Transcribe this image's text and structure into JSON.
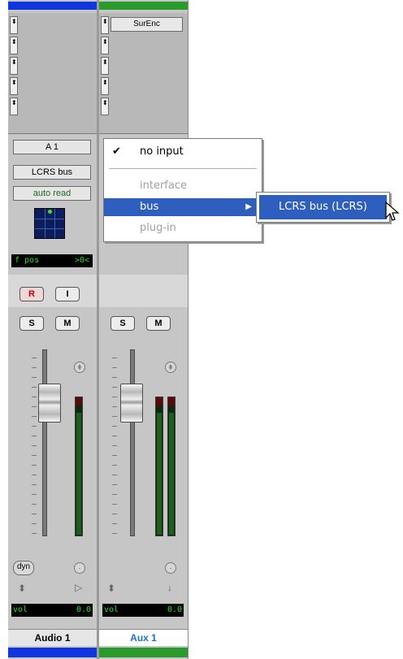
{
  "colors": {
    "audio1_track": "#1036e0",
    "aux1_track": "#2a9a2a",
    "lcd_text": "#22e322",
    "menu_highlight": "#2e5fbf",
    "record_red": "#cc0000",
    "selected_name": "#1a6fd6"
  },
  "strips": [
    {
      "name": "Audio 1",
      "insert_labels": [
        "",
        "",
        "",
        "",
        ""
      ],
      "input": "A 1",
      "output": "LCRS bus",
      "automation": "auto read",
      "pan_lcd": {
        "left": "f pos",
        "right": ">0<"
      },
      "buttons": {
        "rec": "R",
        "input": "I",
        "solo": "S",
        "mute": "M"
      },
      "dyn_label": "dyn",
      "vol_lcd": {
        "left": "vol",
        "right": "0.0"
      }
    },
    {
      "name": "Aux 1",
      "insert_labels": [
        "SurEnc",
        "",
        "",
        "",
        ""
      ],
      "buttons": {
        "solo": "S",
        "mute": "M"
      },
      "vol_lcd": {
        "left": "vol",
        "right": "0.0"
      }
    }
  ],
  "input_menu": {
    "items": [
      {
        "label": "no input",
        "checked": true,
        "enabled": true
      },
      {
        "label": "interface",
        "enabled": false
      },
      {
        "label": "bus",
        "enabled": true,
        "highlighted": true,
        "has_submenu": true
      },
      {
        "label": "plug-in",
        "enabled": false
      }
    ],
    "submenu": {
      "items": [
        {
          "label": "LCRS bus (LCRS)",
          "highlighted": true
        }
      ]
    }
  },
  "icons": {
    "check": "check-icon",
    "submenu_arrow": "chevron-right-icon",
    "cursor": "mouse-pointer-icon",
    "insert_selector": "up-down-arrow-icon",
    "output_pan": "output-arrow-icon",
    "aux_output": "down-arrow-icon",
    "group_indicator": "pin-icon"
  }
}
